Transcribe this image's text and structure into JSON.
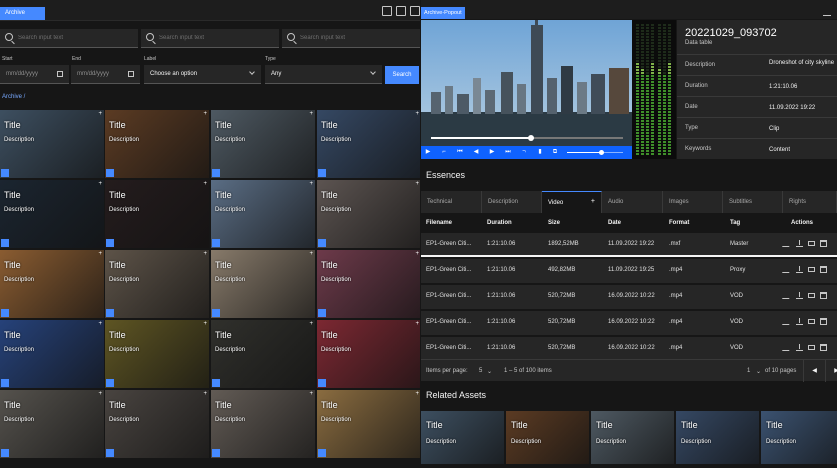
{
  "left": {
    "tab_label": "Archive",
    "search_placeholder": "Search input text",
    "filters": {
      "start_label": "Start",
      "end_label": "End",
      "label_label": "Label",
      "type_label": "Type",
      "date_placeholder": "mm/dd/yyyy",
      "label_value": "Choose an option",
      "type_value": "Any",
      "search_button": "Search"
    },
    "breadcrumb": "Archive  /",
    "tiles": [
      {
        "title": "Title",
        "description": "Description",
        "bg": "#3d4f60"
      },
      {
        "title": "Title",
        "description": "Description",
        "bg": "#5b3b23"
      },
      {
        "title": "Title",
        "description": "Description",
        "bg": "#4e5962"
      },
      {
        "title": "Title",
        "description": "Description",
        "bg": "#354863"
      },
      {
        "title": "Title",
        "description": "Description",
        "bg": "#1b2530"
      },
      {
        "title": "Title",
        "description": "Description",
        "bg": "#241c1d"
      },
      {
        "title": "Title",
        "description": "Description",
        "bg": "#5a6d84"
      },
      {
        "title": "Title",
        "description": "Description",
        "bg": "#5c5451"
      },
      {
        "title": "Title",
        "description": "Description",
        "bg": "#8a5c31"
      },
      {
        "title": "Title",
        "description": "Description",
        "bg": "#5d5348"
      },
      {
        "title": "Title",
        "description": "Description",
        "bg": "#877a6a"
      },
      {
        "title": "Title",
        "description": "Description",
        "bg": "#6d3a4a"
      },
      {
        "title": "Title",
        "description": "Description",
        "bg": "#26427a"
      },
      {
        "title": "Title",
        "description": "Description",
        "bg": "#5e5523"
      },
      {
        "title": "Title",
        "description": "Description",
        "bg": "#30302c"
      },
      {
        "title": "Title",
        "description": "Description",
        "bg": "#7c2832"
      },
      {
        "title": "Title",
        "description": "Description",
        "bg": "#55524d"
      },
      {
        "title": "Title",
        "description": "Description",
        "bg": "#494440"
      },
      {
        "title": "Title",
        "description": "Description",
        "bg": "#625b55"
      },
      {
        "title": "Title",
        "description": "Description",
        "bg": "#8a6c40"
      }
    ]
  },
  "right": {
    "tab_label": "Archive-Popout",
    "meta": {
      "title": "20221029_093702",
      "subtitle": "Data table",
      "rows": [
        {
          "key": "Description",
          "value": "Droneshot of city skyline"
        },
        {
          "key": "Duration",
          "value": "1:21:10.06"
        },
        {
          "key": "Date",
          "value": "11.09.2022 19:22"
        },
        {
          "key": "Type",
          "value": "Clip"
        },
        {
          "key": "Keywords",
          "value": "Content"
        }
      ]
    },
    "player": {
      "progress": 0.52,
      "volume": 0.6
    },
    "essences_title": "Essences",
    "tabs": [
      "Technical",
      "Description",
      "Video",
      "Audio",
      "Images",
      "Subtitles",
      "Rights"
    ],
    "tab_plus": "+",
    "table": {
      "headers": [
        "Filename",
        "Duration",
        "Size",
        "Date",
        "Format",
        "Tag",
        "Actions"
      ],
      "rows": [
        {
          "filename": "EP1-Green Citi...",
          "duration": "1:21:10.06",
          "size": "1892,52MB",
          "date": "11.09.2022 19:22",
          "format": ".mxf",
          "tag": "Master"
        },
        {
          "filename": "EP1-Green Citi...",
          "duration": "1:21:10.06",
          "size": "492,82MB",
          "date": "11.09.2022 19:25",
          "format": ".mp4",
          "tag": "Proxy"
        },
        {
          "filename": "EP1-Green Citi...",
          "duration": "1:21:10.06",
          "size": "520,72MB",
          "date": "16.09.2022 10:22",
          "format": ".mp4",
          "tag": "VOD"
        },
        {
          "filename": "EP1-Green Citi...",
          "duration": "1:21:10.06",
          "size": "520,72MB",
          "date": "16.09.2022 10:22",
          "format": ".mp4",
          "tag": "VOD"
        },
        {
          "filename": "EP1-Green Citi...",
          "duration": "1:21:10.06",
          "size": "520,72MB",
          "date": "16.09.2022 10:22",
          "format": ".mp4",
          "tag": "VOD"
        }
      ]
    },
    "pager": {
      "items_label": "Items per page:",
      "items_value": "5",
      "range": "1 – 5 of 100 items",
      "page_value": "1",
      "pages_label": "of 10 pages"
    },
    "related_title": "Related Assets",
    "related": [
      {
        "title": "Title",
        "description": "Description",
        "bg": "#3d4f60"
      },
      {
        "title": "Title",
        "description": "Description",
        "bg": "#5b3b23"
      },
      {
        "title": "Title",
        "description": "Description",
        "bg": "#4e5962"
      },
      {
        "title": "Title",
        "description": "Description",
        "bg": "#354863"
      },
      {
        "title": "Title",
        "description": "Description",
        "bg": "#3b5270"
      }
    ]
  }
}
